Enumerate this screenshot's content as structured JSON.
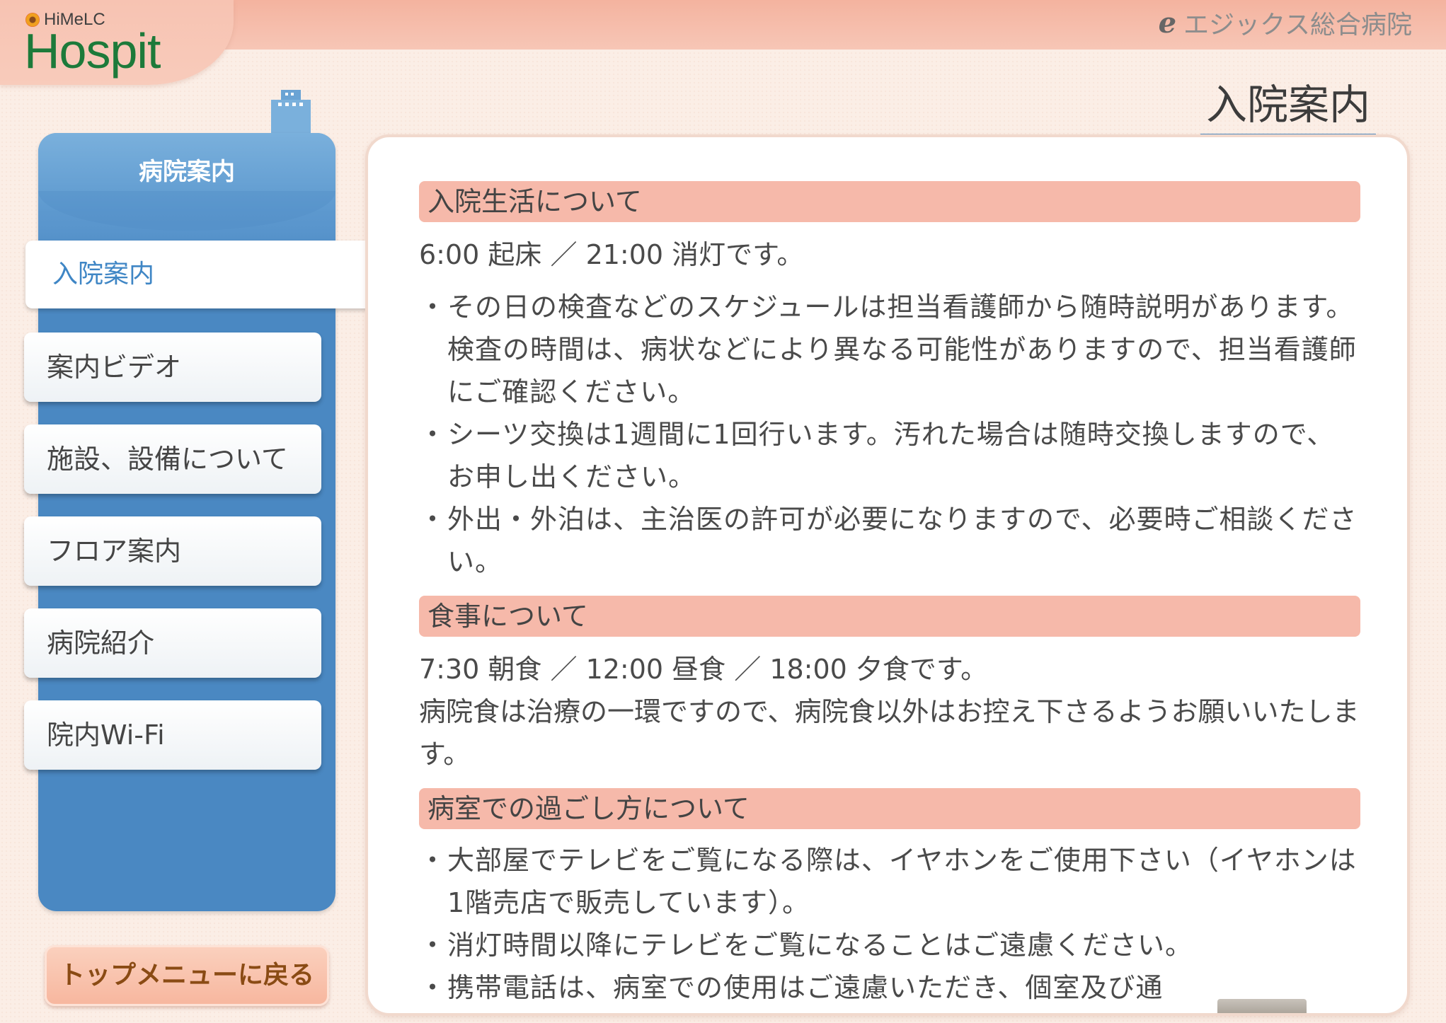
{
  "header": {
    "logo_small": "HiMeLC",
    "logo_big": "Hospit",
    "hospital_name": "エジックス総合病院",
    "page_title": "入院案内",
    "e_icon_glyph": "e"
  },
  "sidebar": {
    "heading": "病院案内",
    "items": [
      {
        "label": "入院案内",
        "active": true
      },
      {
        "label": "案内ビデオ",
        "active": false
      },
      {
        "label": "施設、設備について",
        "active": false
      },
      {
        "label": "フロア案内",
        "active": false
      },
      {
        "label": "病院紹介",
        "active": false
      },
      {
        "label": "院内Wi-Fi",
        "active": false
      }
    ],
    "back_button": "トップメニューに戻る"
  },
  "content": {
    "sections": [
      {
        "title": "入院生活について",
        "lead": "6:00 起床 ／ 21:00 消灯です。",
        "bullets": [
          "その日の検査などのスケジュールは担当看護師から随時説明があります。検査の時間は、病状などにより異なる可能性がありますので、担当看護師にご確認ください。",
          "シーツ交換は1週間に1回行います。汚れた場合は随時交換しますので、お申し出ください。",
          "外出・外泊は、主治医の許可が必要になりますので、必要時ご相談ください。"
        ]
      },
      {
        "title": "食事について",
        "lead": "7:30 朝食 ／ 12:00 昼食 ／ 18:00 夕食です。",
        "paragraph": "病院食は治療の一環ですので、病院食以外はお控え下さるようお願いいたします。"
      },
      {
        "title": "病室での過ごし方について",
        "bullets": [
          "大部屋でテレビをご覧になる際は、イヤホンをご使用下さい（イヤホンは1階売店で販売しています）。",
          "消灯時間以降にテレビをご覧になることはご遠慮ください。",
          "携帯電話は、病室での使用はご遠慮いただき、個室及び通"
        ]
      }
    ]
  },
  "colors": {
    "accent_blue": "#4a88c2",
    "section_pink": "#f6b9aa",
    "logo_green": "#1d7a3a",
    "back_button_text": "#8a4b14"
  }
}
